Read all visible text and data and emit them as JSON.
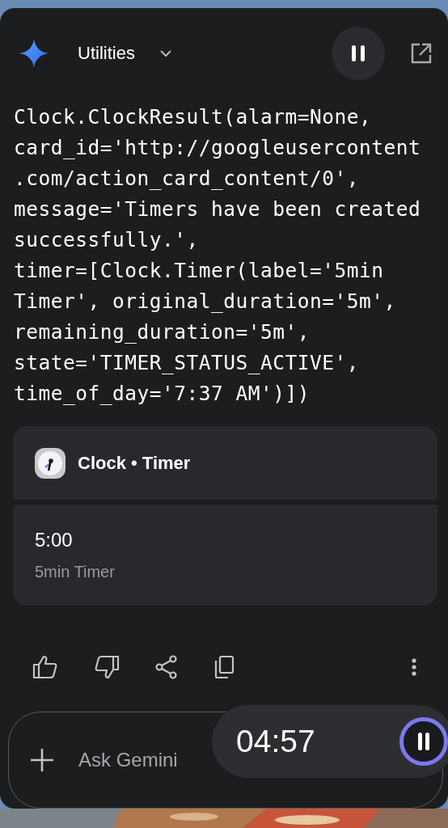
{
  "header": {
    "title": "Utilities"
  },
  "response": {
    "code": "Clock.ClockResult(alarm=None,\ncard_id='http://googleusercontent\n.com/action_card_content/0',\nmessage='Timers have been created\nsuccessfully.',\ntimer=[Clock.Timer(label='5min\nTimer', original_duration='5m',\nremaining_duration='5m',\nstate='TIMER_STATUS_ACTIVE',\ntime_of_day='7:37 AM')])"
  },
  "card": {
    "title": "Clock • Timer",
    "time": "5:00",
    "label": "5min Timer"
  },
  "input": {
    "placeholder": "Ask Gemini"
  },
  "floating_timer": {
    "time": "04:57"
  }
}
